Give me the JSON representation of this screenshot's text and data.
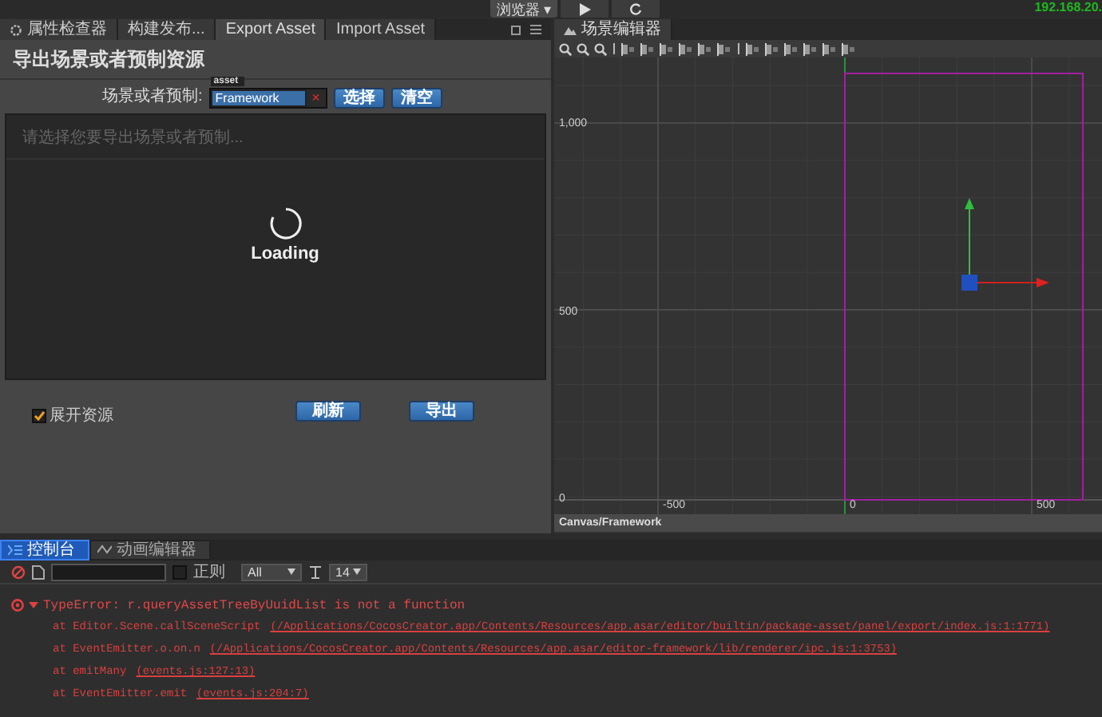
{
  "top_bar": {
    "platform_dropdown": "浏览器 ▾",
    "ip_address": "192.168.20."
  },
  "left_panel": {
    "tabs": [
      {
        "label": "属性检查器",
        "selected": false,
        "kind": "inspector"
      },
      {
        "label": "构建发布...",
        "selected": false,
        "kind": "plain"
      },
      {
        "label": "Export Asset",
        "selected": true,
        "kind": "plain"
      },
      {
        "label": "Import Asset",
        "selected": false,
        "kind": "plain"
      }
    ],
    "title": "导出场景或者预制资源",
    "field_label": "场景或者预制:",
    "field_tag": "asset",
    "field_value": "Framework",
    "clear_mark": "×",
    "select_button": "选择",
    "empty_button": "清空",
    "list_placeholder": "请选择您要导出场景或者预制...",
    "loading_text": "Loading",
    "expand_checkbox": {
      "label": "展开资源",
      "checked": true
    },
    "refresh_button": "刷新",
    "export_button": "导出"
  },
  "scene_panel": {
    "tab": {
      "label": "场景编辑器",
      "selected": true
    },
    "y_labels": [
      "1,000",
      "500",
      "0"
    ],
    "x_labels": [
      "-500",
      "0",
      "500"
    ],
    "breadcrumb": "Canvas/Framework"
  },
  "console": {
    "tabs": [
      {
        "label": "控制台",
        "selected": true,
        "kind": "console"
      },
      {
        "label": "动画编辑器",
        "selected": false,
        "kind": "animation"
      }
    ],
    "regex": {
      "label": "正则",
      "checked": false
    },
    "level_select": "All",
    "font_size_select": "14",
    "logs": [
      {
        "kind": "error",
        "expanded": true,
        "text": "TypeError: r.queryAssetTreeByUuidList is not a function"
      },
      {
        "kind": "trace",
        "text": "at Editor.Scene.callSceneScript",
        "link": "(/Applications/CocosCreator.app/Contents/Resources/app.asar/editor/builtin/package-asset/panel/export/index.js:1:1771)"
      },
      {
        "kind": "trace",
        "text": "at EventEmitter.o.on.n",
        "link": "(/Applications/CocosCreator.app/Contents/Resources/app.asar/editor-framework/lib/renderer/ipc.js:1:3753)"
      },
      {
        "kind": "trace",
        "text": "at emitMany",
        "link": "(events.js:127:13)"
      },
      {
        "kind": "trace",
        "text": "at EventEmitter.emit",
        "link": "(events.js:204:7)"
      }
    ]
  }
}
